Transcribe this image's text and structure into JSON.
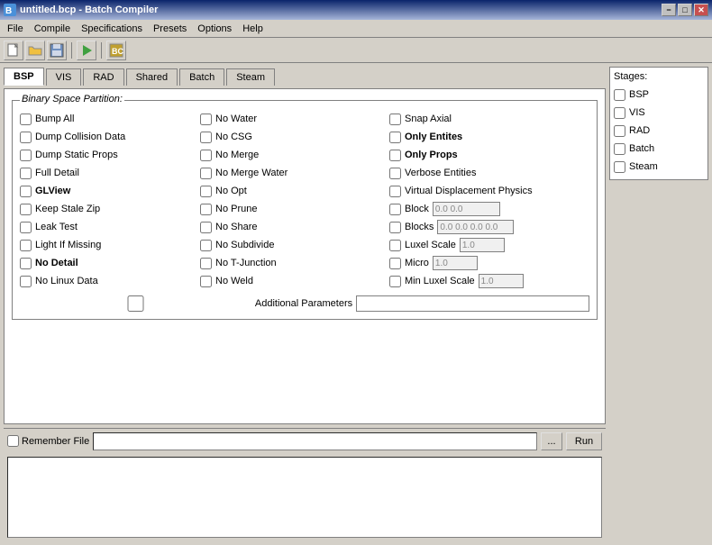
{
  "titleBar": {
    "title": "untitled.bcp - Batch Compiler",
    "minimize": "−",
    "maximize": "□",
    "close": "✕"
  },
  "menuBar": {
    "items": [
      "File",
      "Compile",
      "Specifications",
      "Presets",
      "Options",
      "Help"
    ]
  },
  "toolbar": {
    "buttons": [
      "new",
      "open",
      "save",
      "separator",
      "play",
      "separator",
      "compile"
    ]
  },
  "tabs": {
    "items": [
      "BSP",
      "VIS",
      "RAD",
      "Shared",
      "Batch",
      "Steam"
    ],
    "active": "BSP"
  },
  "bspGroup": {
    "title": "Binary Space Partition:",
    "col1": [
      {
        "id": "bumpAll",
        "label": "Bump All",
        "bold": false,
        "checked": false
      },
      {
        "id": "dumpCollision",
        "label": "Dump Collision Data",
        "bold": false,
        "checked": false
      },
      {
        "id": "dumpStatic",
        "label": "Dump Static Props",
        "bold": false,
        "checked": false
      },
      {
        "id": "fullDetail",
        "label": "Full Detail",
        "bold": false,
        "checked": false
      },
      {
        "id": "glView",
        "label": "GLView",
        "bold": true,
        "checked": false
      },
      {
        "id": "keepStale",
        "label": "Keep Stale Zip",
        "bold": false,
        "checked": false
      },
      {
        "id": "leakTest",
        "label": "Leak Test",
        "bold": false,
        "checked": false
      },
      {
        "id": "lightMissing",
        "label": "Light If Missing",
        "bold": false,
        "checked": false
      },
      {
        "id": "noDetail",
        "label": "No Detail",
        "bold": true,
        "checked": false
      },
      {
        "id": "noLinux",
        "label": "No Linux Data",
        "bold": false,
        "checked": false
      }
    ],
    "col2": [
      {
        "id": "noWater",
        "label": "No Water",
        "bold": false,
        "checked": false
      },
      {
        "id": "noCSG",
        "label": "No CSG",
        "bold": false,
        "checked": false
      },
      {
        "id": "noMerge",
        "label": "No Merge",
        "bold": false,
        "checked": false
      },
      {
        "id": "noMergeWater",
        "label": "No Merge Water",
        "bold": false,
        "checked": false
      },
      {
        "id": "noOpt",
        "label": "No Opt",
        "bold": false,
        "checked": false
      },
      {
        "id": "noPrune",
        "label": "No Prune",
        "bold": false,
        "checked": false
      },
      {
        "id": "noShare",
        "label": "No Share",
        "bold": false,
        "checked": false
      },
      {
        "id": "noSubdivide",
        "label": "No Subdivide",
        "bold": false,
        "checked": false
      },
      {
        "id": "noTJunction",
        "label": "No T-Junction",
        "bold": false,
        "checked": false
      },
      {
        "id": "noWeld",
        "label": "No Weld",
        "bold": false,
        "checked": false
      }
    ],
    "col3": [
      {
        "id": "snapAxial",
        "label": "Snap Axial",
        "bold": false,
        "checked": false,
        "hasInput": false
      },
      {
        "id": "onlyEntities",
        "label": "Only Entites",
        "bold": true,
        "checked": false,
        "hasInput": false
      },
      {
        "id": "onlyProps",
        "label": "Only Props",
        "bold": true,
        "checked": false,
        "hasInput": false
      },
      {
        "id": "verboseEntities",
        "label": "Verbose Entities",
        "bold": false,
        "checked": false,
        "hasInput": false
      },
      {
        "id": "virtualDisplacement",
        "label": "Virtual Displacement Physics",
        "bold": false,
        "checked": false,
        "hasInput": false
      },
      {
        "id": "block",
        "label": "Block",
        "bold": false,
        "checked": false,
        "hasInput": true,
        "inputValue": "0.0 0.0"
      },
      {
        "id": "blocks",
        "label": "Blocks",
        "bold": false,
        "checked": false,
        "hasInput": true,
        "inputValue": "0.0 0.0 0.0 0.0"
      },
      {
        "id": "luxelScale",
        "label": "Luxel Scale",
        "bold": false,
        "checked": false,
        "hasInput": true,
        "inputValue": "1.0"
      },
      {
        "id": "micro",
        "label": "Micro",
        "bold": false,
        "checked": false,
        "hasInput": true,
        "inputValue": "1.0"
      },
      {
        "id": "minLuxelScale",
        "label": "Min Luxel Scale",
        "bold": false,
        "checked": false,
        "hasInput": true,
        "inputValue": "1.0"
      }
    ],
    "additionalParams": {
      "label": "Additional Parameters",
      "value": ""
    }
  },
  "bottomBar": {
    "rememberFile": "Remember File",
    "browseLabel": "...",
    "runLabel": "Run"
  },
  "stages": {
    "title": "Stages:",
    "items": [
      {
        "id": "stageBSP",
        "label": "BSP",
        "checked": false
      },
      {
        "id": "stageVIS",
        "label": "VIS",
        "checked": false
      },
      {
        "id": "stageRAD",
        "label": "RAD",
        "checked": false
      },
      {
        "id": "stageBatch",
        "label": "Batch",
        "checked": false
      },
      {
        "id": "stageSteam",
        "label": "Steam",
        "checked": false
      }
    ]
  }
}
